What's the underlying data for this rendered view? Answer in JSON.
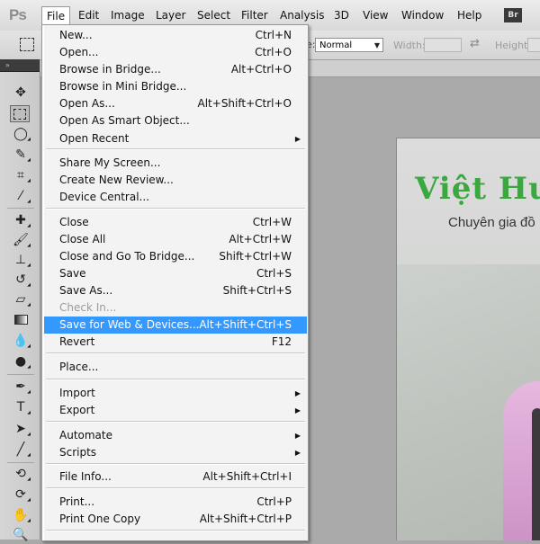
{
  "app": {
    "logo": "Ps"
  },
  "menubar": {
    "items": [
      "File",
      "Edit",
      "Image",
      "Layer",
      "Select",
      "Filter",
      "Analysis",
      "3D",
      "View",
      "Window",
      "Help"
    ],
    "bridge_badge": "Br"
  },
  "options_bar": {
    "style_value": "Normal",
    "style_label": "e:",
    "width_label": "Width:",
    "height_label": "Height:"
  },
  "tools_panel": {
    "collapse_glyph": "»"
  },
  "canvas": {
    "brand_text": "Việt Hu",
    "tagline_text": "Chuyên gia đồ"
  },
  "file_menu": {
    "items": [
      {
        "label": "New...",
        "shortcut": "Ctrl+N"
      },
      {
        "label": "Open...",
        "shortcut": "Ctrl+O"
      },
      {
        "label": "Browse in Bridge...",
        "shortcut": "Alt+Ctrl+O"
      },
      {
        "label": "Browse in Mini Bridge...",
        "shortcut": ""
      },
      {
        "label": "Open As...",
        "shortcut": "Alt+Shift+Ctrl+O"
      },
      {
        "label": "Open As Smart Object...",
        "shortcut": ""
      },
      {
        "label": "Open Recent",
        "shortcut": "",
        "submenu": true
      },
      {
        "label": "Share My Screen...",
        "shortcut": ""
      },
      {
        "label": "Create New Review...",
        "shortcut": ""
      },
      {
        "label": "Device Central...",
        "shortcut": ""
      },
      {
        "label": "Close",
        "shortcut": "Ctrl+W"
      },
      {
        "label": "Close All",
        "shortcut": "Alt+Ctrl+W"
      },
      {
        "label": "Close and Go To Bridge...",
        "shortcut": "Shift+Ctrl+W"
      },
      {
        "label": "Save",
        "shortcut": "Ctrl+S"
      },
      {
        "label": "Save As...",
        "shortcut": "Shift+Ctrl+S"
      },
      {
        "label": "Check In...",
        "shortcut": "",
        "disabled": true
      },
      {
        "label": "Save for Web & Devices...",
        "shortcut": "Alt+Shift+Ctrl+S",
        "highlighted": true
      },
      {
        "label": "Revert",
        "shortcut": "F12"
      },
      {
        "label": "Place...",
        "shortcut": ""
      },
      {
        "label": "Import",
        "shortcut": "",
        "submenu": true
      },
      {
        "label": "Export",
        "shortcut": "",
        "submenu": true
      },
      {
        "label": "Automate",
        "shortcut": "",
        "submenu": true
      },
      {
        "label": "Scripts",
        "shortcut": "",
        "submenu": true
      },
      {
        "label": "File Info...",
        "shortcut": "Alt+Shift+Ctrl+I"
      },
      {
        "label": "Print...",
        "shortcut": "Ctrl+P"
      },
      {
        "label": "Print One Copy",
        "shortcut": "Alt+Shift+Ctrl+P"
      }
    ]
  },
  "colors": {
    "menu_highlight": "#3399ff",
    "brand_green": "#3ba83f"
  }
}
